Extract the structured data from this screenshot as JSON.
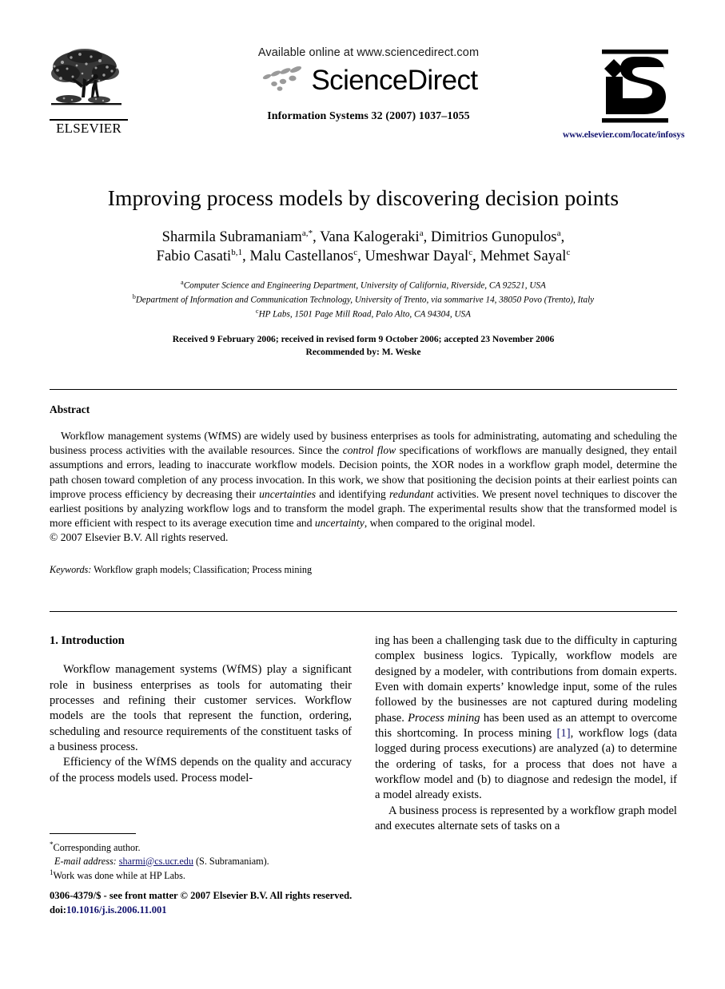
{
  "masthead": {
    "publisher_name": "ELSEVIER",
    "available_online": "Available online at www.sciencedirect.com",
    "sciencedirect_wordmark": "ScienceDirect",
    "journal_reference": "Information Systems 32 (2007) 1037–1055",
    "journal_logo_text": "iS",
    "journal_url": "www.elsevier.com/locate/infosys"
  },
  "article": {
    "title": "Improving process models by discovering decision points",
    "authors_line_1": "Sharmila Subramaniam",
    "authors_line_1_sup": "a,*",
    "authors_line_1b": ", Vana Kalogeraki",
    "authors_line_1b_sup": "a",
    "authors_line_1c": ", Dimitrios Gunopulos",
    "authors_line_1c_sup": "a",
    "authors_line_1d": ",",
    "authors_line_2": "Fabio Casati",
    "authors_line_2_sup": "b,1",
    "authors_line_2b": ", Malu Castellanos",
    "authors_line_2b_sup": "c",
    "authors_line_2c": ", Umeshwar Dayal",
    "authors_line_2c_sup": "c",
    "authors_line_2d": ", Mehmet Sayal",
    "authors_line_2d_sup": "c",
    "affiliations": [
      {
        "marker": "a",
        "text": "Computer Science and Engineering Department, University of California, Riverside, CA 92521, USA"
      },
      {
        "marker": "b",
        "text": "Department of Information and Communication Technology, University of Trento, via sommarive 14, 38050 Povo (Trento), Italy"
      },
      {
        "marker": "c",
        "text": "HP Labs, 1501 Page Mill Road, Palo Alto, CA 94304, USA"
      }
    ],
    "history_line_1": "Received 9 February 2006; received in revised form 9 October 2006; accepted 23 November 2006",
    "history_line_2": "Recommended by: M. Weske"
  },
  "abstract": {
    "heading": "Abstract",
    "paragraph_part_1": "Workflow management systems (WfMS) are widely used by business enterprises as tools for administrating, automating and scheduling the business process activities with the available resources. Since the ",
    "italic_1": "control flow",
    "paragraph_part_2": " specifications of workflows are manually designed, they entail assumptions and errors, leading to inaccurate workflow models. Decision points, the XOR nodes in a workflow graph model, determine the path chosen toward completion of any process invocation. In this work, we show that positioning the decision points at their earliest points can improve process efficiency by decreasing their ",
    "italic_2": "uncertainties",
    "paragraph_part_3": " and identifying ",
    "italic_3": "redundant",
    "paragraph_part_4": " activities. We present novel techniques to discover the earliest positions by analyzing workflow logs and to transform the model graph. The experimental results show that the transformed model is more efficient with respect to its average execution time and ",
    "italic_4": "uncertainty",
    "paragraph_part_5": ", when compared to the original model.",
    "copyright": "© 2007 Elsevier B.V. All rights reserved.",
    "keywords_label": "Keywords:",
    "keywords_value": " Workflow graph models; Classification; Process mining"
  },
  "introduction": {
    "section_number_and_title": "1.  Introduction",
    "left_paragraph_1": "Workflow management systems (WfMS) play a significant role in business enterprises as tools for automating their processes and refining their customer services. Workflow models are the tools that represent the function, ordering, scheduling and resource requirements of the constituent tasks of a business process.",
    "left_paragraph_2": "Efficiency of the WfMS depends on the quality and accuracy of the process models used. Process model-",
    "right_paragraph_1_part_1": "ing has been a challenging task due to the difficulty in capturing complex business logics. Typically, workflow models are designed by a modeler, with contributions from domain experts. Even with domain experts’ knowledge input, some of the rules followed by the businesses are not captured during modeling phase. ",
    "right_italic_1": "Process mining",
    "right_paragraph_1_part_2": " has been used as an attempt to overcome this shortcoming. In process mining ",
    "right_citation_1": "[1]",
    "right_paragraph_1_part_3": ", workflow logs (data logged during process executions) are analyzed (a) to determine the ordering of tasks, for a process that does not have a workflow model and (b) to diagnose and redesign the model, if a model already exists.",
    "right_paragraph_2": "A business process is represented by a workflow graph model and executes alternate sets of tasks on a"
  },
  "footnotes": {
    "corresponding_author_marker": "*",
    "corresponding_author": "Corresponding author.",
    "email_label": "E-mail address:",
    "email_address": "sharmi@cs.ucr.edu",
    "email_owner": "(S. Subramaniam).",
    "note_1_marker": "1",
    "note_1": "Work was done while at HP Labs."
  },
  "footer": {
    "issn_line": "0306-4379/$ - see front matter © 2007 Elsevier B.V. All rights reserved.",
    "doi_label": "doi:",
    "doi_value": "10.1016/j.is.2006.11.001"
  },
  "colors": {
    "link": "#11126e",
    "text": "#000000",
    "page_background": "#ffffff"
  }
}
